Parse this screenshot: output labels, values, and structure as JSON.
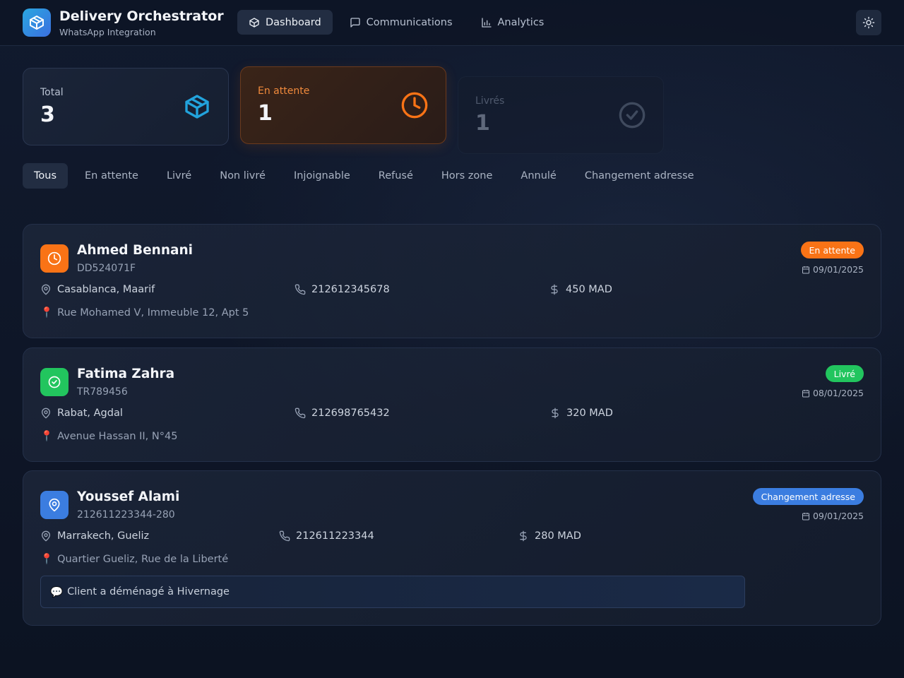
{
  "app": {
    "title": "Delivery Orchestrator",
    "subtitle": "WhatsApp Integration"
  },
  "nav": [
    {
      "label": "Dashboard",
      "icon": "box-icon",
      "active": true
    },
    {
      "label": "Communications",
      "icon": "message-square-icon",
      "active": false
    },
    {
      "label": "Analytics",
      "icon": "bar-chart-icon",
      "active": false
    }
  ],
  "theme_toggle": {
    "icon": "sun-icon"
  },
  "stats": {
    "total": {
      "label": "Total",
      "value": "3",
      "icon": "box-icon",
      "color": "#22a3dc"
    },
    "pending": {
      "label": "En attente",
      "value": "1",
      "icon": "clock-icon",
      "color": "#f97316"
    },
    "delivered": {
      "label": "Livrés",
      "value": "1",
      "icon": "check-circle-icon",
      "color": "#6b7689"
    }
  },
  "filters": [
    {
      "label": "Tous",
      "active": true
    },
    {
      "label": "En attente",
      "active": false
    },
    {
      "label": "Livré",
      "active": false
    },
    {
      "label": "Non livré",
      "active": false
    },
    {
      "label": "Injoignable",
      "active": false
    },
    {
      "label": "Refusé",
      "active": false
    },
    {
      "label": "Hors zone",
      "active": false
    },
    {
      "label": "Annulé",
      "active": false
    },
    {
      "label": "Changement adresse",
      "active": false
    }
  ],
  "orders": [
    {
      "name": "Ahmed Bennani",
      "ref": "DD524071F",
      "status": "En attente",
      "status_color": "#f97316",
      "status_icon": "clock-icon",
      "date": "09/01/2025",
      "city": "Casablanca, Maarif",
      "phone": "212612345678",
      "amount": "450 MAD",
      "address": "Rue Mohamed V, Immeuble 12, Apt 5",
      "note": ""
    },
    {
      "name": "Fatima Zahra",
      "ref": "TR789456",
      "status": "Livré",
      "status_color": "#22c55e",
      "status_icon": "check-circle-icon",
      "date": "08/01/2025",
      "city": "Rabat, Agdal",
      "phone": "212698765432",
      "amount": "320 MAD",
      "address": "Avenue Hassan II, N°45",
      "note": ""
    },
    {
      "name": "Youssef Alami",
      "ref": "212611223344-280",
      "status": "Changement adresse",
      "status_color": "#3b7de0",
      "status_icon": "map-pin-icon",
      "date": "09/01/2025",
      "city": "Marrakech, Gueliz",
      "phone": "212611223344",
      "amount": "280 MAD",
      "address": "Quartier Gueliz, Rue de la Liberté",
      "note": "Client a déménagé à Hivernage"
    }
  ]
}
